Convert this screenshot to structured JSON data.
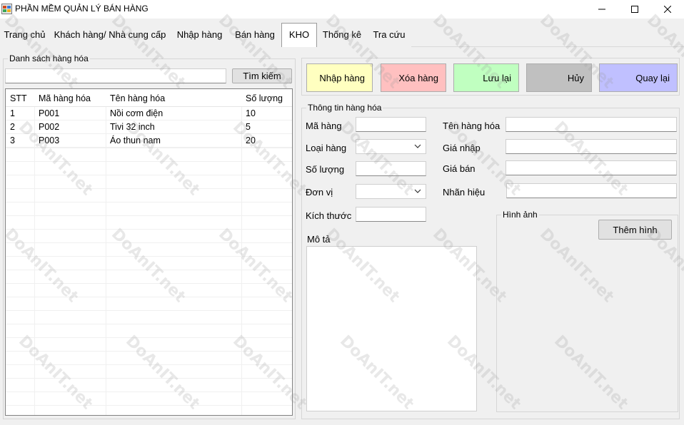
{
  "window": {
    "title": "PHẦN MỀM QUẢN LÝ BÁN HÀNG"
  },
  "tabs": [
    {
      "label": "Trang chủ"
    },
    {
      "label": "Khách hàng/ Nhà cung cấp"
    },
    {
      "label": "Nhập hàng"
    },
    {
      "label": "Bán hàng"
    },
    {
      "label": "KHO"
    },
    {
      "label": "Thống kê"
    },
    {
      "label": "Tra cứu"
    }
  ],
  "list_panel": {
    "title": "Danh sách hàng hóa",
    "search_value": "",
    "search_button": "Tìm kiếm",
    "columns": [
      "STT",
      "Mã hàng hóa",
      "Tên hàng hóa",
      "Số lượng"
    ],
    "rows": [
      [
        "1",
        "P001",
        "Nồi cơm điện",
        "10"
      ],
      [
        "2",
        "P002",
        "Tivi 32 inch",
        "5"
      ],
      [
        "3",
        "P003",
        "Áo thun nam",
        "20"
      ]
    ]
  },
  "toolbar": {
    "import": "Nhập hàng",
    "delete": "Xóa hàng",
    "save": "Lưu lại",
    "cancel": "Hủy",
    "back": "Quay lại"
  },
  "colors": {
    "import": "#ffffc0",
    "delete": "#ffc0c0",
    "save": "#c0ffc0",
    "cancel": "#c0c0c0",
    "back": "#c0c0ff"
  },
  "details": {
    "title": "Thông tin hàng hóa",
    "code_label": "Mã hàng",
    "name_label": "Tên hàng hóa",
    "category_label": "Loại hàng",
    "import_price_label": "Giá nhập",
    "quantity_label": "Số lượng",
    "sale_price_label": "Giá bán",
    "unit_label": "Đơn vị",
    "brand_label": "Nhãn hiệu",
    "size_label": "Kích thước",
    "description_label": "Mô tả",
    "image_group": "Hình ảnh",
    "add_image_button": "Thêm hình"
  },
  "watermark": {
    "text": "DoAnIT.net"
  }
}
